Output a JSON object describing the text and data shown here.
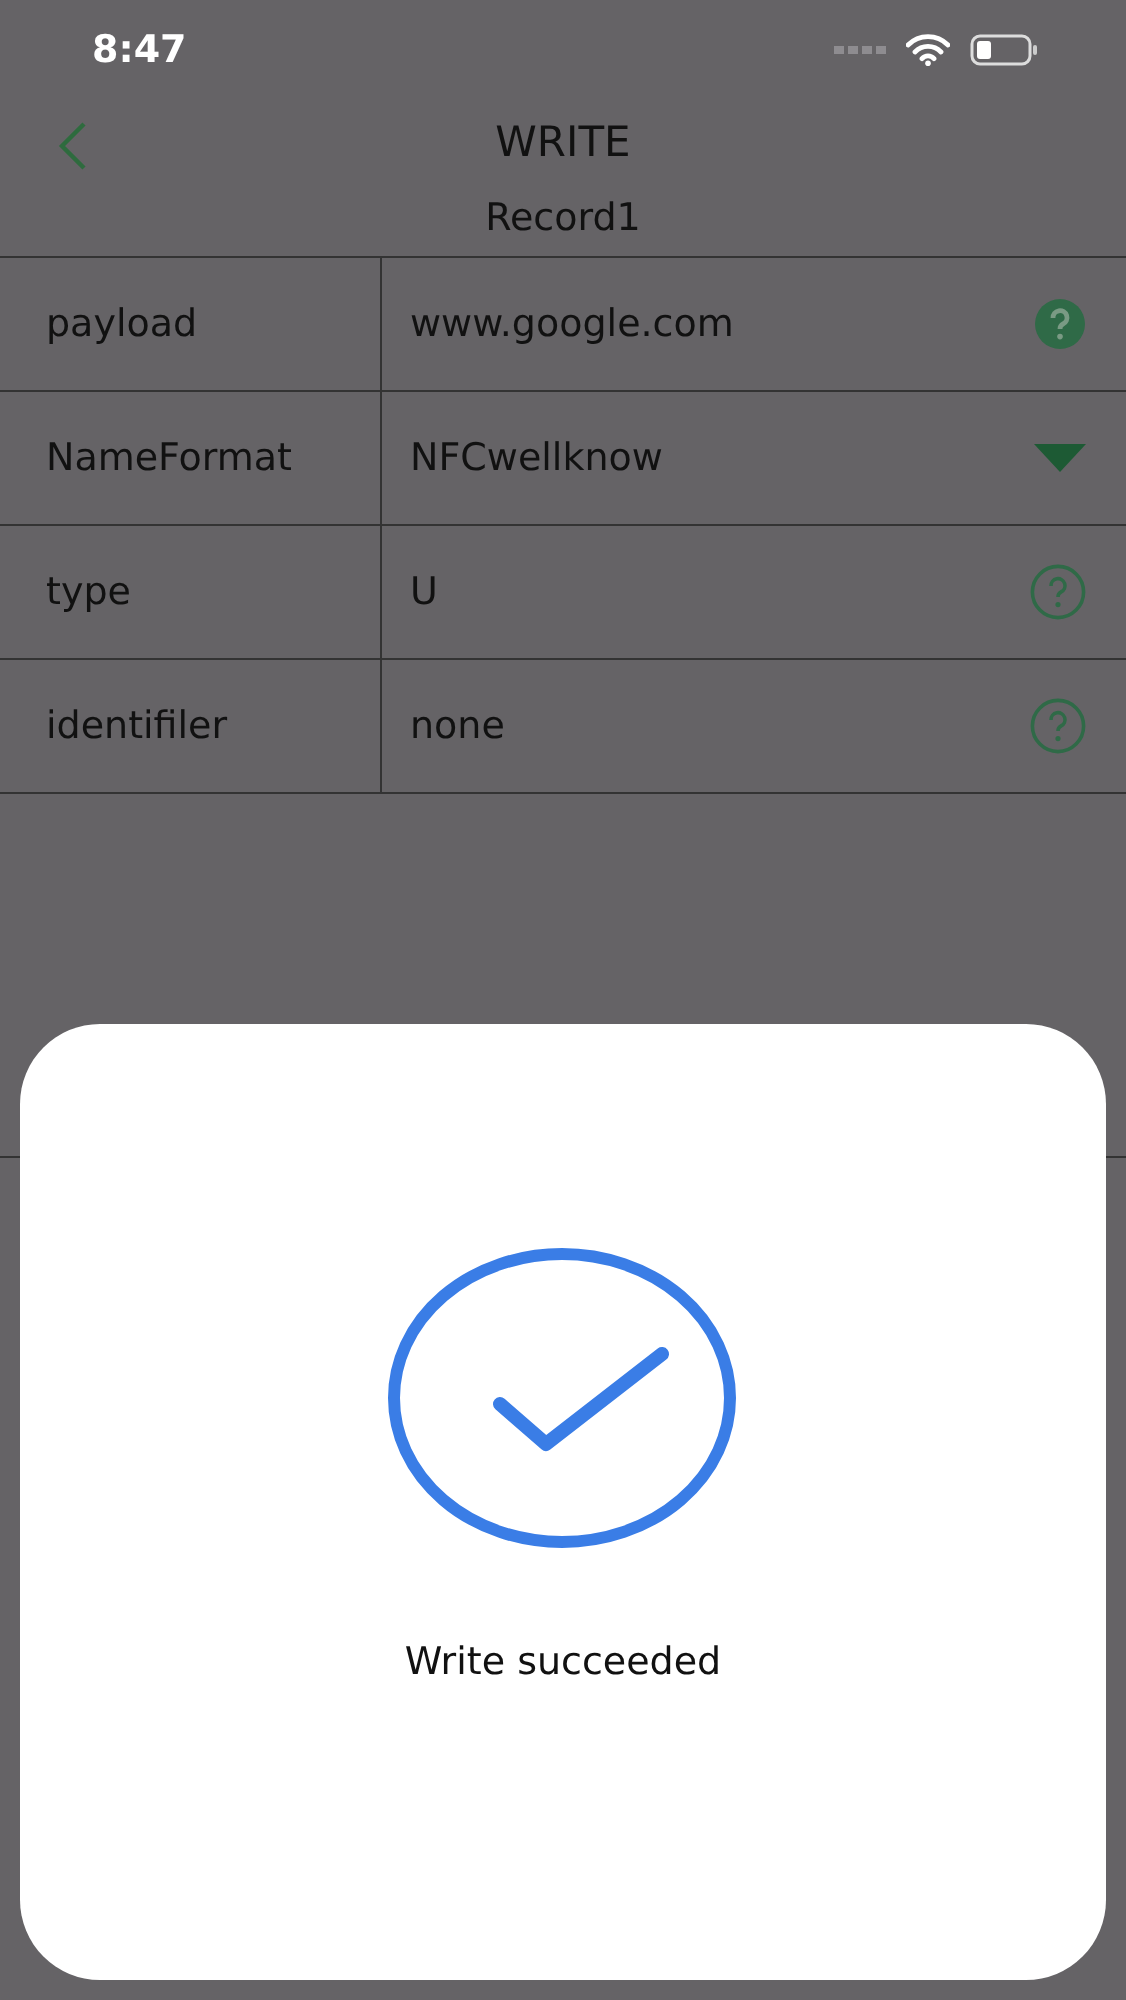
{
  "status_bar": {
    "time": "8:47"
  },
  "nav": {
    "title": "WRITE",
    "subtitle": "Record1"
  },
  "rows": [
    {
      "label": "payload",
      "value": "www.google.com",
      "kind": "help-filled"
    },
    {
      "label": "NameFormat",
      "value": "NFCwellknow",
      "kind": "dropdown"
    },
    {
      "label": "type",
      "value": "U",
      "kind": "help-outline"
    },
    {
      "label": "identifiler",
      "value": "none",
      "kind": "help-outline"
    }
  ],
  "dialog": {
    "message": "Write succeeded"
  }
}
